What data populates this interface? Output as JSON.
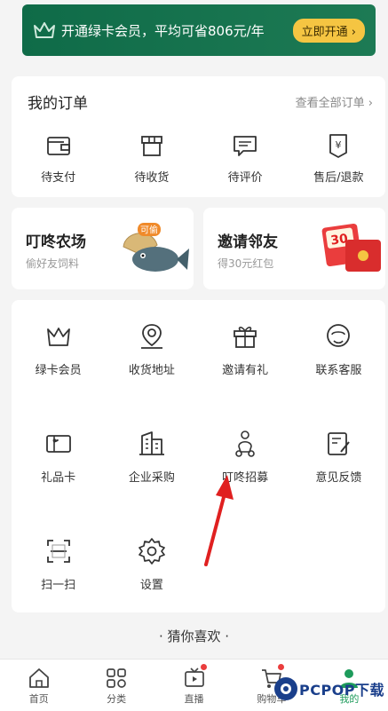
{
  "vip_banner": {
    "text": "开通绿卡会员，平均可省806元/年",
    "button": "立即开通"
  },
  "orders": {
    "title": "我的订单",
    "view_all": "查看全部订单",
    "items": [
      {
        "label": "待支付",
        "icon": "wallet-icon"
      },
      {
        "label": "待收货",
        "icon": "box-icon"
      },
      {
        "label": "待评价",
        "icon": "comment-icon"
      },
      {
        "label": "售后/退款",
        "icon": "refund-icon"
      }
    ]
  },
  "promos": [
    {
      "title": "叮咚农场",
      "subtitle": "偷好友饲料",
      "badge": "可偷"
    },
    {
      "title": "邀请邻友",
      "subtitle": "得30元红包",
      "badge": "30"
    }
  ],
  "services": [
    {
      "label": "绿卡会员",
      "icon": "crown-icon"
    },
    {
      "label": "收货地址",
      "icon": "location-icon"
    },
    {
      "label": "邀请有礼",
      "icon": "gift-icon"
    },
    {
      "label": "联系客服",
      "icon": "service-icon"
    },
    {
      "label": "礼品卡",
      "icon": "gift-card-icon"
    },
    {
      "label": "企业采购",
      "icon": "building-icon"
    },
    {
      "label": "叮咚招募",
      "icon": "rider-icon"
    },
    {
      "label": "意见反馈",
      "icon": "feedback-icon"
    },
    {
      "label": "扫一扫",
      "icon": "scan-icon"
    },
    {
      "label": "设置",
      "icon": "gear-icon"
    }
  ],
  "guess_title": "· 猜你喜欢 ·",
  "tabbar": [
    {
      "label": "首页",
      "icon": "home-icon"
    },
    {
      "label": "分类",
      "icon": "category-icon"
    },
    {
      "label": "直播",
      "icon": "live-icon"
    },
    {
      "label": "购物车",
      "icon": "cart-icon"
    },
    {
      "label": "我的",
      "icon": "profile-icon"
    }
  ],
  "watermark": "PCPOP下载",
  "colors": {
    "brand_green": "#1d7a54",
    "vip_button": "#f5c542",
    "active_tab": "#1d9b5b",
    "arrow_red": "#e02020",
    "badge_red": "#ea3d3d"
  }
}
